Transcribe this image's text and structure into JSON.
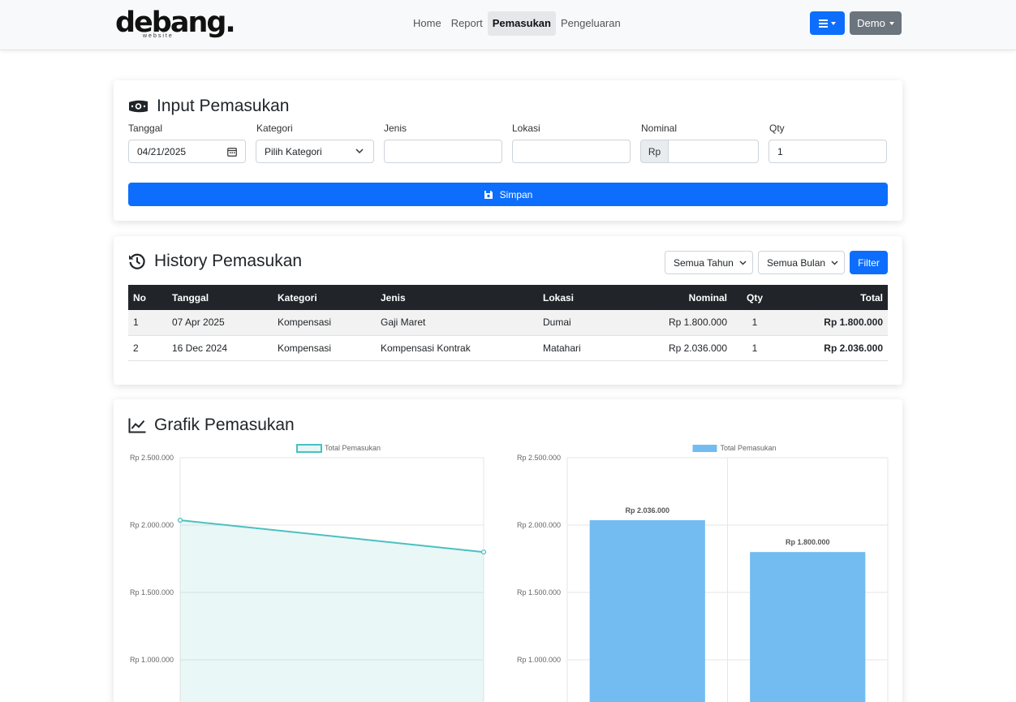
{
  "navbar": {
    "logo_text": "debang.",
    "logo_sub": "website",
    "links": [
      "Home",
      "Report",
      "Pemasukan",
      "Pengeluaran"
    ],
    "active_link": "Pemasukan",
    "menu_icon": "bars-icon",
    "user_label": "Demo"
  },
  "input_card": {
    "title": "Input Pemasukan",
    "icon": "money-bill-icon",
    "fields": {
      "tanggal": {
        "label": "Tanggal",
        "value": "04/21/2025"
      },
      "kategori": {
        "label": "Kategori",
        "value": "Pilih Kategori"
      },
      "jenis": {
        "label": "Jenis",
        "value": ""
      },
      "lokasi": {
        "label": "Lokasi",
        "value": ""
      },
      "nominal": {
        "label": "Nominal",
        "prefix": "Rp",
        "value": ""
      },
      "qty": {
        "label": "Qty",
        "value": "1"
      }
    },
    "submit_label": "Simpan"
  },
  "history_card": {
    "title": "History Pemasukan",
    "icon": "history-icon",
    "year_filter": "Semua Tahun",
    "month_filter": "Semua Bulan",
    "filter_label": "Filter",
    "columns": [
      "No",
      "Tanggal",
      "Kategori",
      "Jenis",
      "Lokasi",
      "Nominal",
      "Qty",
      "Total"
    ],
    "rows": [
      [
        "1",
        "07 Apr 2025",
        "Kompensasi",
        "Gaji Maret",
        "Dumai",
        "Rp 1.800.000",
        "1",
        "Rp 1.800.000"
      ],
      [
        "2",
        "16 Dec 2024",
        "Kompensasi",
        "Kompensasi Kontrak",
        "Matahari",
        "Rp 2.036.000",
        "1",
        "Rp 2.036.000"
      ]
    ]
  },
  "chart_card": {
    "title": "Grafik Pemasukan",
    "icon": "chart-line-icon"
  },
  "chart_data": [
    {
      "type": "area",
      "legend": "Total Pemasukan",
      "series": [
        {
          "name": "Total Pemasukan",
          "values": [
            2036000,
            1800000
          ]
        }
      ],
      "yticks": [
        "Rp 2.500.000",
        "Rp 2.000.000",
        "Rp 1.500.000",
        "Rp 1.000.000"
      ],
      "ylim": [
        1000000,
        2500000
      ],
      "color": "#4bc0c0"
    },
    {
      "type": "bar",
      "legend": "Total Pemasukan",
      "values": [
        2036000,
        1800000
      ],
      "data_labels": [
        "Rp 2.036.000",
        "Rp 1.800.000"
      ],
      "yticks": [
        "Rp 2.500.000",
        "Rp 2.000.000",
        "Rp 1.500.000",
        "Rp 1.000.000"
      ],
      "ylim": [
        1000000,
        2500000
      ],
      "color": "#72bcf1"
    }
  ]
}
